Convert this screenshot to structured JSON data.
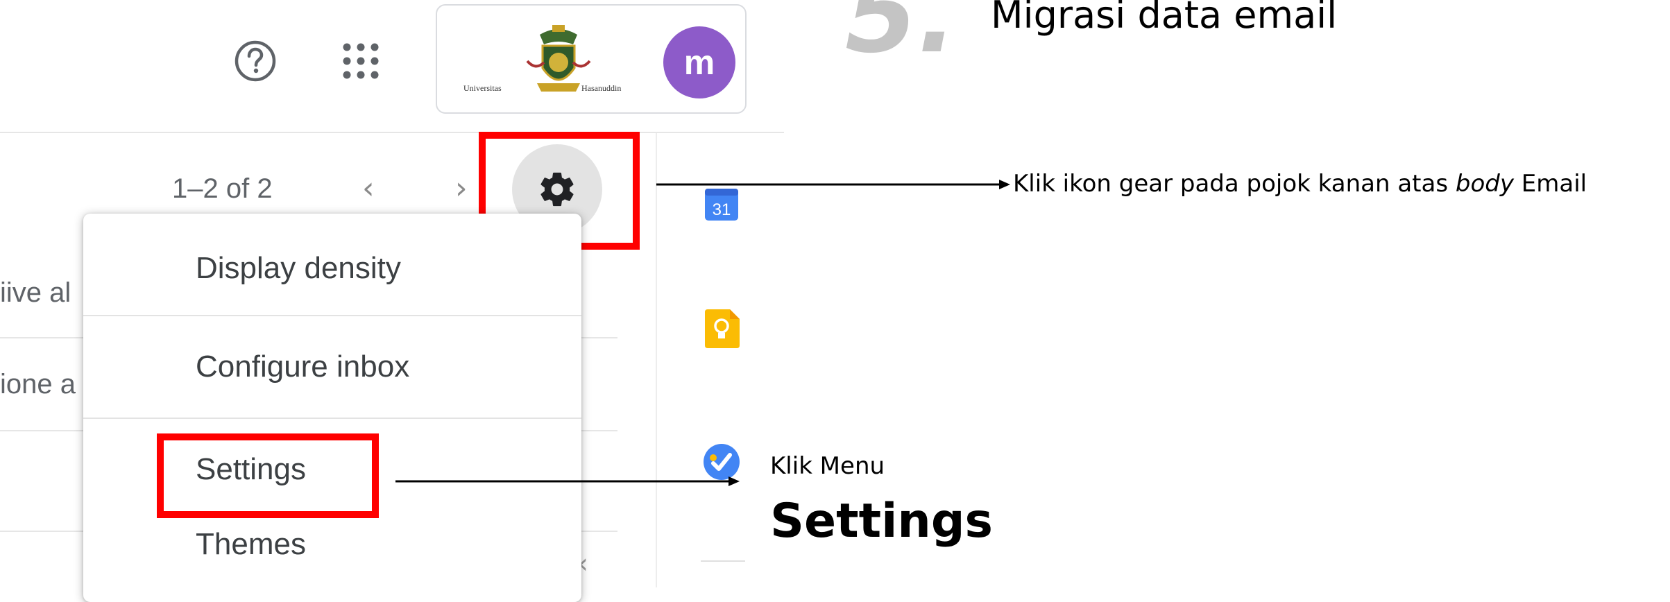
{
  "header": {
    "help_icon": "help-circle-icon",
    "apps_icon": "apps-grid-icon",
    "logo": {
      "left_text": "Universitas",
      "right_text": "Hasanuddin"
    },
    "avatar_letter": "m",
    "avatar_color": "#8d5bc9"
  },
  "toolbar": {
    "pagination": "1–2 of 2",
    "prev_glyph": "‹",
    "next_glyph": "›",
    "settings_icon": "gear-icon"
  },
  "list_fragments": [
    "iive al",
    "ione a"
  ],
  "settings_menu": {
    "items": [
      {
        "label": "Display density"
      },
      {
        "label": "Configure inbox"
      },
      {
        "label": "Settings"
      },
      {
        "label": "Themes"
      }
    ]
  },
  "side_panel": {
    "calendar_label": "31",
    "icons": [
      "calendar-icon",
      "keep-icon",
      "tasks-icon"
    ]
  },
  "annotations": {
    "step_number": "5.",
    "step_title": "Migrasi data email",
    "gear_note_pre": "Klik ikon gear pada pojok kanan atas ",
    "gear_note_em": "body",
    "gear_note_post": " Email",
    "settings_note_small": "Klik Menu",
    "settings_note_big": "Settings"
  },
  "colors": {
    "highlight": "#ff0000",
    "gear_bg": "#e3e3e3",
    "avatar": "#8d5bc9",
    "calendar": "#4285f4",
    "keep": "#fbbc04",
    "tasks": "#4285f4"
  }
}
